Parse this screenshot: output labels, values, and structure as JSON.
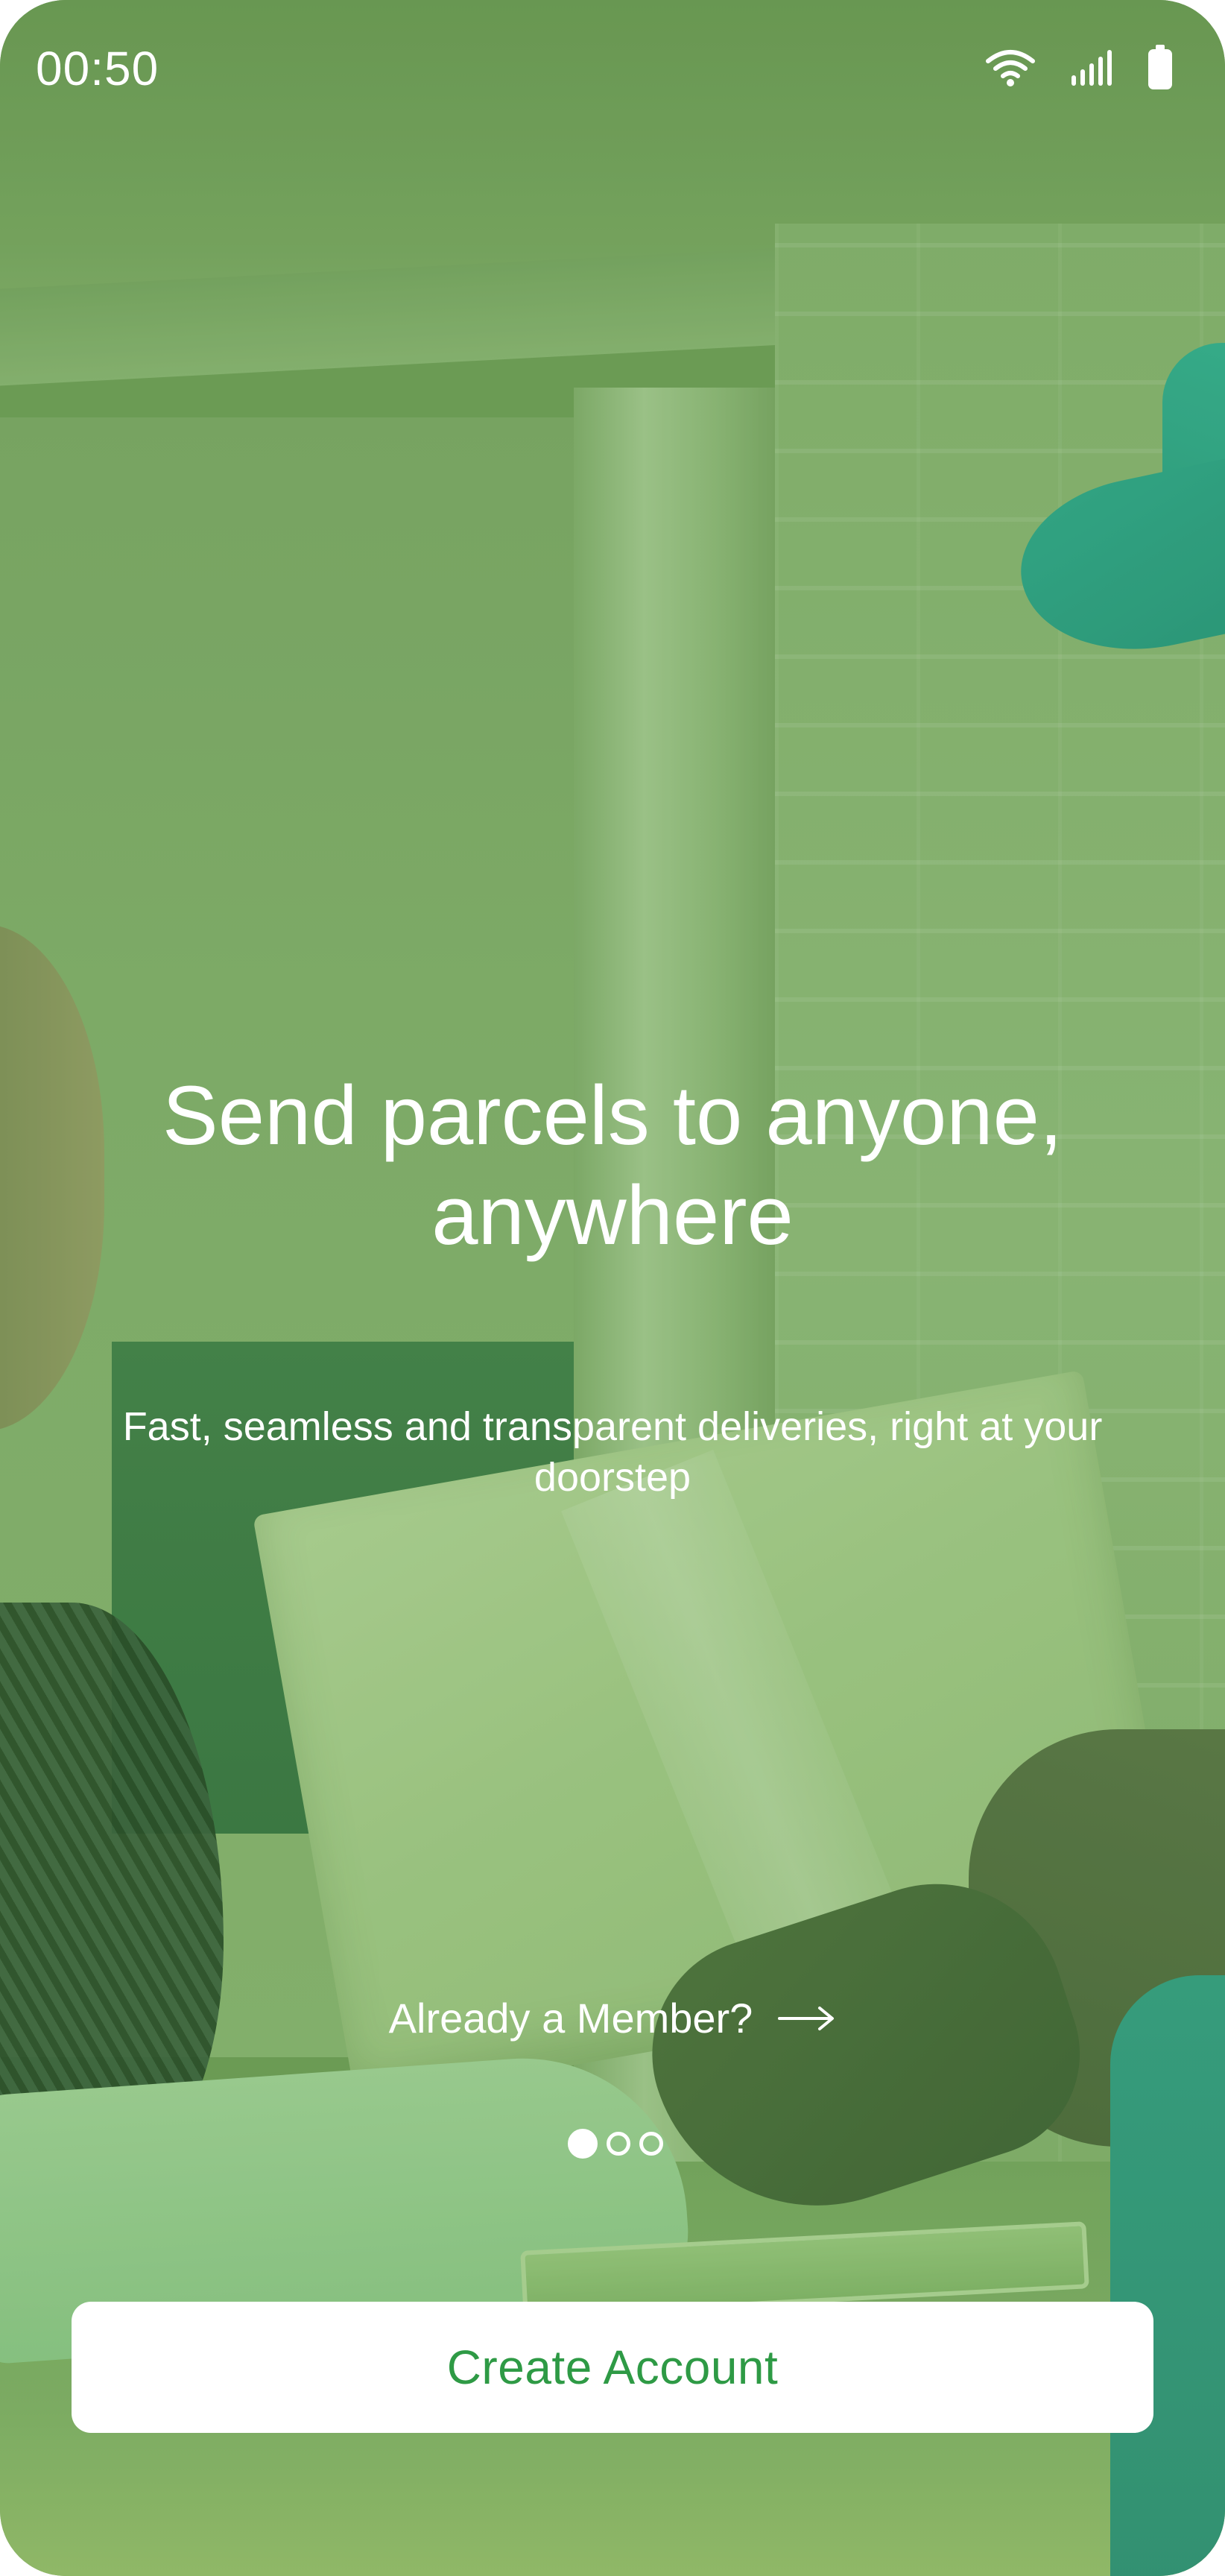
{
  "status_bar": {
    "time": "00:50",
    "icons": [
      "wifi-icon",
      "signal-icon",
      "battery-icon"
    ]
  },
  "onboarding": {
    "title": "Send parcels to anyone, anywhere",
    "subtitle": "Fast, seamless and transparent deliveries, right at your doorstep",
    "member_link_label": "Already a Member?",
    "member_link_icon": "arrow-right-icon",
    "pager": {
      "total_pages": 3,
      "current_page": 1
    },
    "create_account_label": "Create Account"
  },
  "colors": {
    "overlay_green": "#6f9a56",
    "button_background": "#ffffff",
    "button_text": "#2e9a45",
    "text": "#ffffff"
  }
}
